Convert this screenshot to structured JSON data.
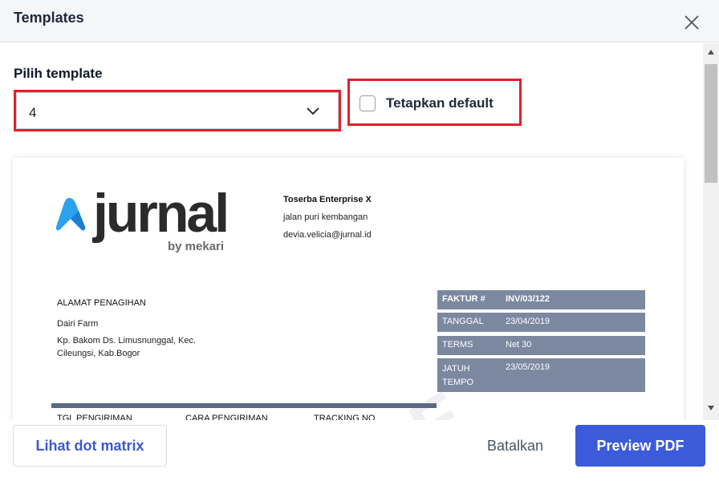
{
  "header": {
    "title": "Templates"
  },
  "form": {
    "template_label": "Pilih template",
    "template_value": "4",
    "default_label": "Tetapkan default",
    "default_checked": false
  },
  "preview": {
    "logo_word": "jurnal",
    "logo_sub": "by mekari",
    "company": {
      "name": "Toserba Enterprise X",
      "address": "jalan puri kembangan",
      "email": "devia.velicia@jurnal.id"
    },
    "billing": {
      "title": "ALAMAT PENAGIHAN",
      "name": "Dairi Farm",
      "address_line1": "Kp. Bakom Ds. Limusnunggal, Kec.",
      "address_line2": "Cileungsi, Kab.Bogor"
    },
    "invoice": [
      {
        "key": "FAKTUR #",
        "value": "INV/03/122"
      },
      {
        "key": "TANGGAL",
        "value": "23/04/2019"
      },
      {
        "key": "TERMS",
        "value": "Net 30"
      },
      {
        "key": "JATUH TEMPO",
        "value": "23/05/2019"
      }
    ],
    "columns": [
      "TGL PENGIRIMAN",
      "CARA PENGIRIMAN",
      "TRACKING NO"
    ]
  },
  "footer": {
    "dot_matrix_label": "Lihat dot matrix",
    "cancel_label": "Batalkan",
    "preview_label": "Preview PDF"
  },
  "colors": {
    "accent": "#3b5bdb",
    "highlight": "#e0202a",
    "invoice_bg": "#7b88a0",
    "logo_blue": "#2aa3ec"
  }
}
